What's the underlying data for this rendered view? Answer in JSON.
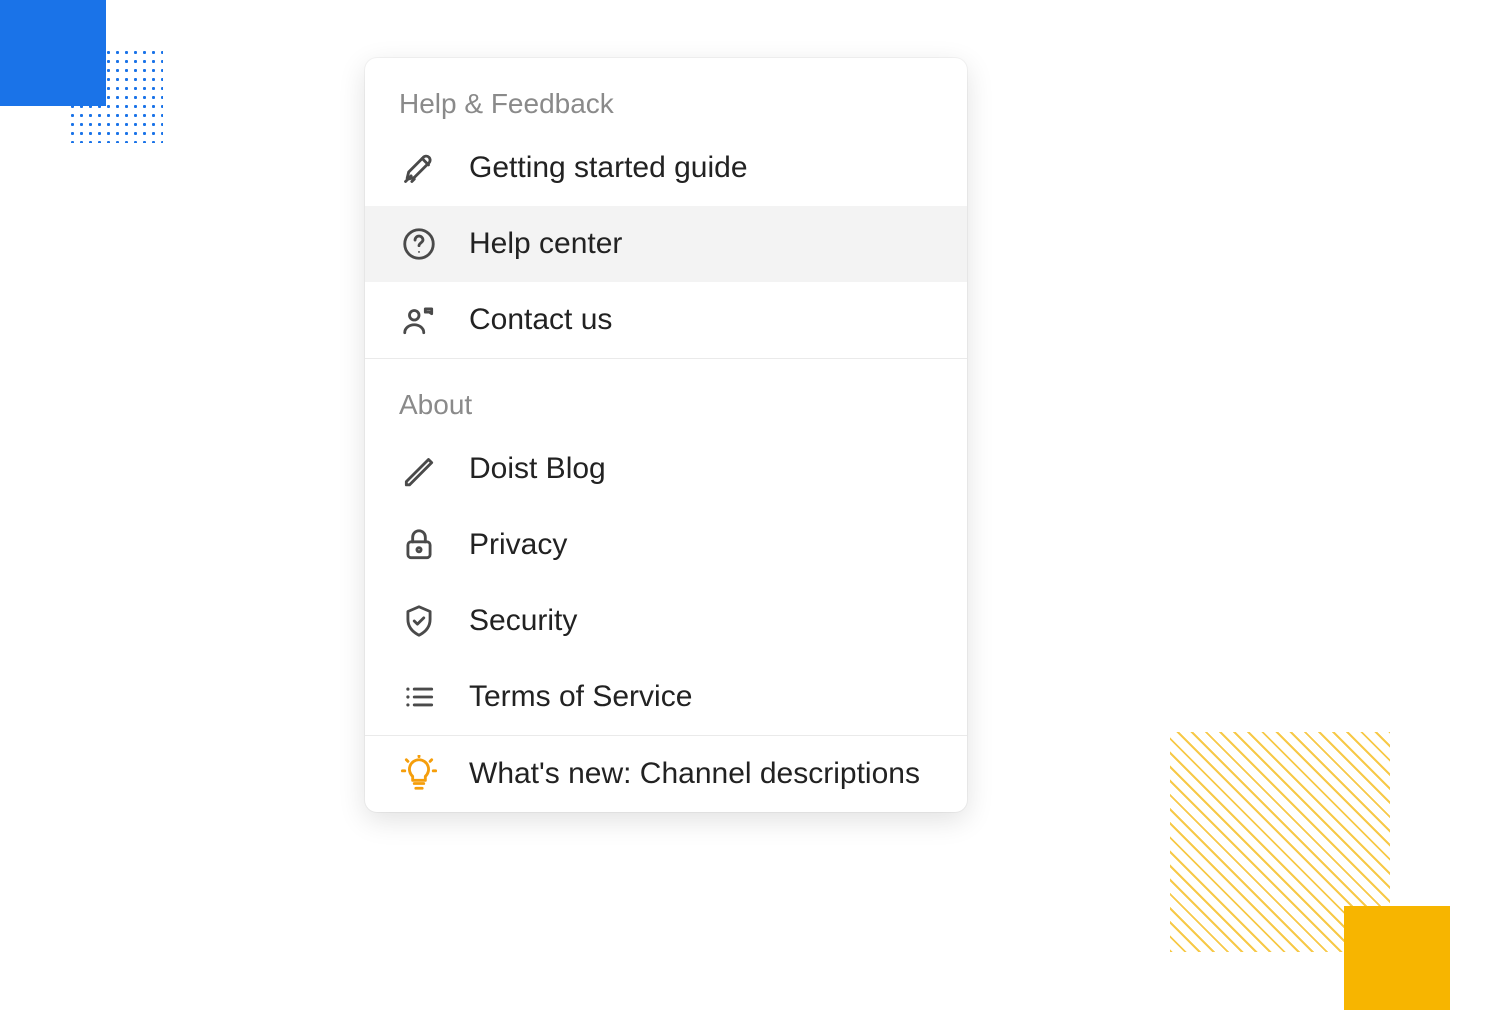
{
  "decor": {
    "blue_square_color": "#1a73e8",
    "dot_grid_color": "#1a73e8",
    "diag_color": "#f7c948",
    "orange_square_color": "#f7b500"
  },
  "menu": {
    "sections": [
      {
        "title": "Help & Feedback",
        "items": [
          {
            "icon": "rocket-icon",
            "label": "Getting started guide",
            "highlight": false,
            "hover": false
          },
          {
            "icon": "question-icon",
            "label": "Help center",
            "highlight": false,
            "hover": true
          },
          {
            "icon": "contact-icon",
            "label": "Contact us",
            "highlight": false,
            "hover": false
          }
        ]
      },
      {
        "title": "About",
        "items": [
          {
            "icon": "pencil-icon",
            "label": "Doist Blog",
            "highlight": false,
            "hover": false
          },
          {
            "icon": "lock-icon",
            "label": "Privacy",
            "highlight": false,
            "hover": false
          },
          {
            "icon": "shield-icon",
            "label": "Security",
            "highlight": false,
            "hover": false
          },
          {
            "icon": "list-icon",
            "label": "Terms of Service",
            "highlight": false,
            "hover": false
          }
        ]
      },
      {
        "title": null,
        "items": [
          {
            "icon": "lightbulb-icon",
            "label": "What's new: Channel descriptions",
            "highlight": true,
            "hover": false
          }
        ]
      }
    ]
  }
}
